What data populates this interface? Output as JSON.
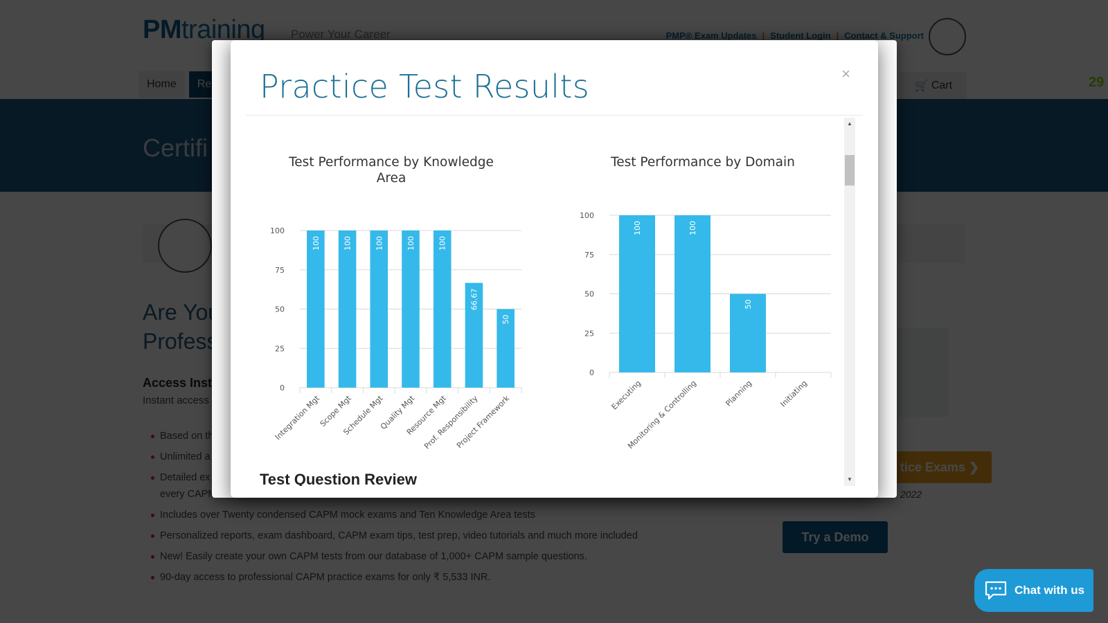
{
  "site": {
    "logo_bold": "PM",
    "logo_rest": "training",
    "tagline": "Power Your Career",
    "top_links": [
      "PMP® Exam Updates",
      "Student Login",
      "Contact & Support"
    ],
    "nav": [
      "Home",
      "Re"
    ],
    "cart_label": "Cart",
    "counter": "29",
    "hero_title": "Certifi",
    "heading_line1": "Are You",
    "heading_line2": "Profess",
    "access_title": "Access Inst",
    "access_sub": "Instant access",
    "bullets": [
      "Based on th",
      "Unlimited a",
      "Detailed ex",
      "every CAPM",
      "Includes over Twenty condensed CAPM mock exams and Ten Knowledge Area tests",
      "Personalized reports, exam dashboard, CAPM exam tips, test prep, video tutorials and much more included",
      "New! Easily create your own CAPM tests from our database of 1,000+ CAPM sample questions.",
      "90-day access to professional CAPM practice exams for only ₹ 5,533 INR."
    ],
    "cta_practice": "tice Exams ❯",
    "year": "2022",
    "demo_button": "Try a Demo",
    "chat_label": "Chat with us"
  },
  "modal": {
    "title": "Practice Test Results",
    "close_label": "×",
    "next_section_peek": "Test Question Review"
  },
  "colors": {
    "bar": "#35b9ea",
    "grid": "#d8d8d8",
    "title": "#1a6f95"
  },
  "chart_data": [
    {
      "type": "bar",
      "title": "Test Performance by Knowledge Area",
      "title_lines": [
        "Test Performance by Knowledge",
        "Area"
      ],
      "categories": [
        "Integration Mgt",
        "Scope Mgt",
        "Schedule Mgt",
        "Quality Mgt",
        "Resource Mgt",
        "Prof. Responsibility",
        "Project Framework"
      ],
      "values": [
        100,
        100,
        100,
        100,
        100,
        66.67,
        50
      ],
      "value_labels": [
        "100",
        "100",
        "100",
        "100",
        "100",
        "66.67",
        "50"
      ],
      "ylim": [
        0,
        100
      ],
      "yticks": [
        0,
        25,
        50,
        75,
        100
      ],
      "xlabel": "",
      "ylabel": "",
      "grid": true,
      "legend": "none"
    },
    {
      "type": "bar",
      "title": "Test Performance by Domain",
      "title_lines": [
        "Test Performance by Domain"
      ],
      "categories": [
        "Executing",
        "Monitoring & Controlling",
        "Planning",
        "Initiating"
      ],
      "values": [
        100,
        100,
        50,
        0
      ],
      "value_labels": [
        "100",
        "100",
        "50",
        ""
      ],
      "ylim": [
        0,
        100
      ],
      "yticks": [
        0,
        25,
        50,
        75,
        100
      ],
      "xlabel": "",
      "ylabel": "",
      "grid": true,
      "legend": "none"
    }
  ]
}
